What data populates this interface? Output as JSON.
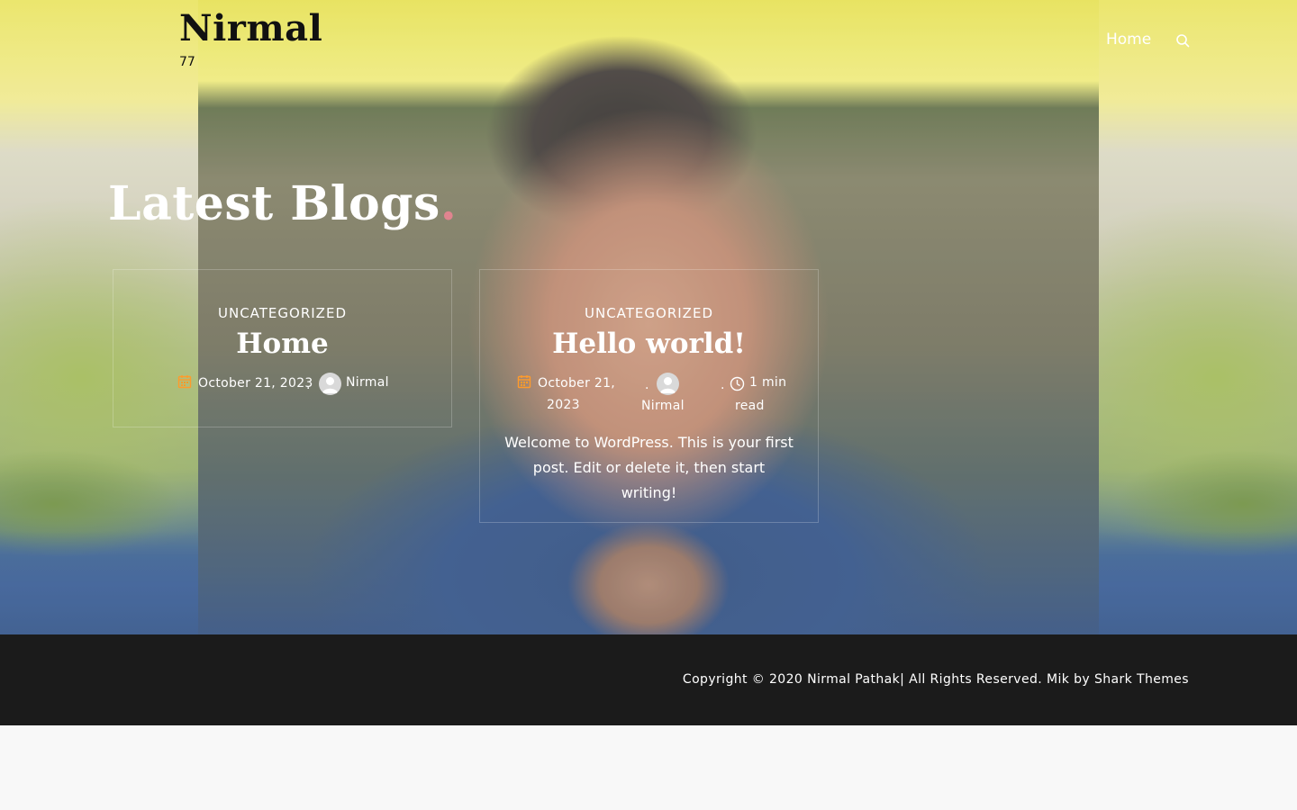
{
  "site": {
    "title": "Nirmal",
    "tagline": "77"
  },
  "nav": {
    "home": "Home"
  },
  "section": {
    "title": "Latest Blogs",
    "dot": "."
  },
  "posts": [
    {
      "category": "UNCATEGORIZED",
      "title": "Home",
      "date": "October 21, 2023",
      "author": "Nirmal"
    },
    {
      "category": "UNCATEGORIZED",
      "title": "Hello world!",
      "date_line1": "October 21,",
      "date_line2": "2023",
      "author": "Nirmal",
      "read_line1": "1 min",
      "read_line2": "read",
      "excerpt": "Welcome to WordPress. This is your first post. Edit or delete it, then start writing!"
    }
  ],
  "meta_separator": ".",
  "footer": {
    "copyright": "Copyright © 2020 Nirmal Pathak| All Rights Reserved. Mik by ",
    "credit": "Shark Themes"
  },
  "colors": {
    "accent_dot": "#e0848f",
    "footer_bg": "#1b1b1b",
    "page_bg": "#f8f8f8"
  },
  "icons": [
    "search-icon",
    "calendar-icon",
    "avatar-icon",
    "clock-icon"
  ]
}
